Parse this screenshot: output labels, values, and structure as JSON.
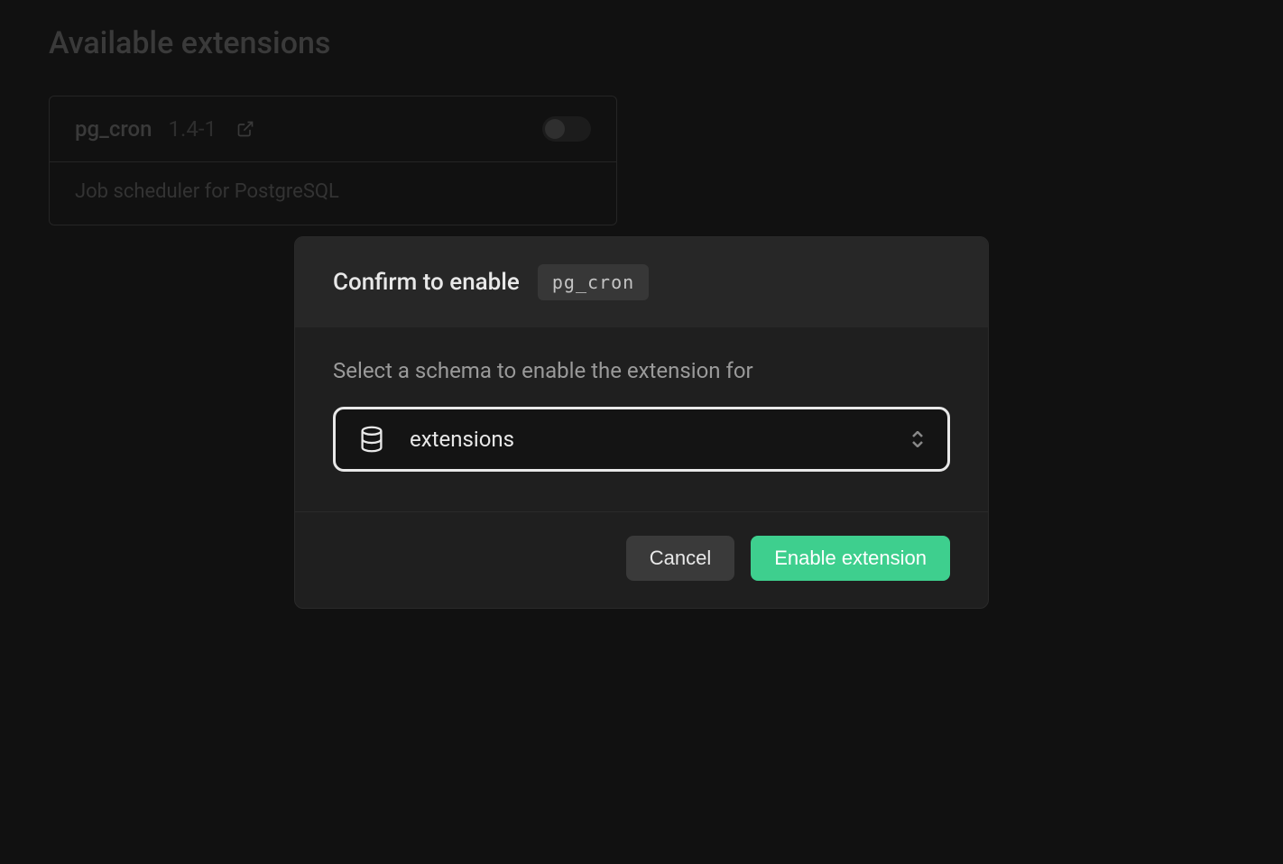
{
  "page": {
    "title": "Available extensions"
  },
  "extension": {
    "name": "pg_cron",
    "version": "1.4-1",
    "description": "Job scheduler for PostgreSQL"
  },
  "modal": {
    "title": "Confirm to enable",
    "chip": "pg_cron",
    "select_label": "Select a schema to enable the extension for",
    "selected_schema": "extensions",
    "cancel_label": "Cancel",
    "confirm_label": "Enable extension"
  }
}
